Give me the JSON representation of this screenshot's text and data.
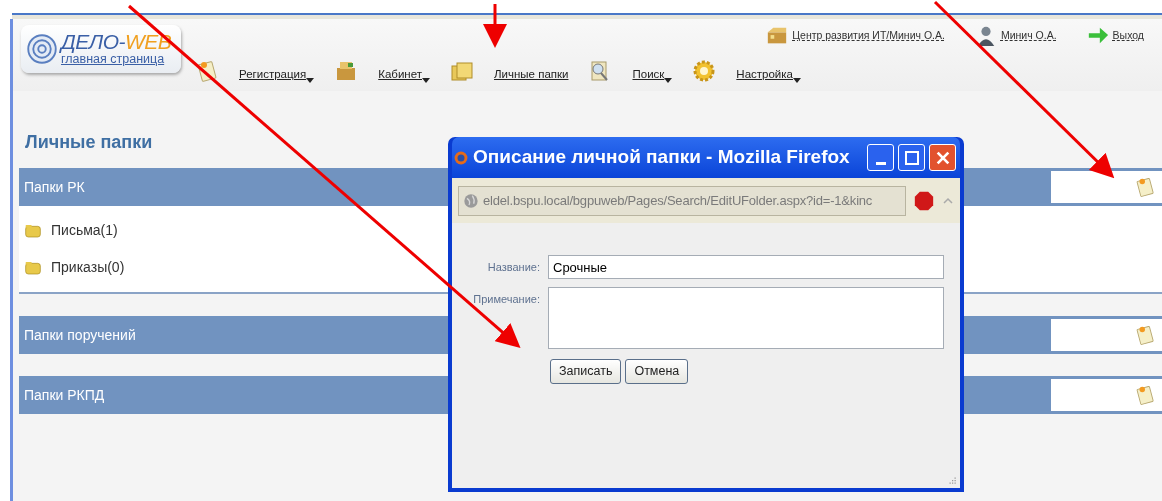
{
  "header": {
    "logo": {
      "title_main": "ДЕЛО-",
      "title_accent": "WEB",
      "subtitle": "главная страница"
    },
    "menu": [
      {
        "label": "Регистрация",
        "dropdown": true,
        "kind": "register"
      },
      {
        "label": "Кабинет",
        "dropdown": true,
        "kind": "cabinet"
      },
      {
        "label": "Личные папки",
        "dropdown": false,
        "kind": "folders"
      },
      {
        "label": "Поиск",
        "dropdown": true,
        "kind": "search"
      },
      {
        "label": "Настройка",
        "dropdown": true,
        "kind": "settings"
      }
    ],
    "top_links": [
      {
        "label": "Центр развития ИТ/Минич О.А.",
        "kind": "department"
      },
      {
        "label": "Минич О.А.",
        "kind": "user"
      },
      {
        "label": "Выход",
        "kind": "exit"
      }
    ]
  },
  "page_title": "Личные папки",
  "sections": [
    {
      "title": "Папки РК",
      "items": [
        "Письма(1)",
        "Приказы(0)"
      ]
    },
    {
      "title": "Папки поручений"
    },
    {
      "title": "Папки РКПД"
    }
  ],
  "dialog": {
    "title": "Описание личной папки - Mozilla Firefox",
    "url": "eldel.bspu.local/bgpuweb/Pages/Search/EditUFolder.aspx?id=-1&kinc",
    "fields": [
      {
        "label": "Название:",
        "kind": "text",
        "value": "Срочные"
      },
      {
        "label": "Примечание:",
        "kind": "textarea"
      }
    ],
    "buttons": [
      "Записать",
      "Отмена"
    ]
  }
}
